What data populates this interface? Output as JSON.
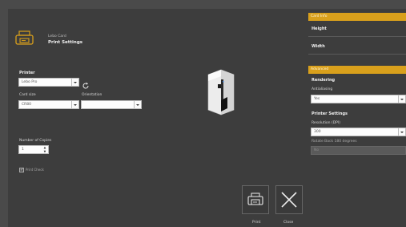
{
  "header": {
    "subtitle": "Lebo Card",
    "title": "Print Settings",
    "icon": "card-printer-icon"
  },
  "printer": {
    "label": "Printer",
    "value": "Lebo Pro",
    "refresh_icon": "refresh-icon"
  },
  "card_size": {
    "label": "Card size",
    "value": "CR80"
  },
  "orientation": {
    "label": "Orientation",
    "value": ""
  },
  "copies": {
    "label": "Number of Copies",
    "value": "1"
  },
  "print_check": {
    "label": "Print Check",
    "checked": true
  },
  "card_panel": {
    "header": "Card Info",
    "height_label": "Height",
    "width_label": "Width"
  },
  "advanced_panel": {
    "header": "Advanced",
    "rendering_title": "Rendering",
    "antialias_label": "Antialiasing",
    "antialias_value": "Yes",
    "printer_settings_title": "Printer Settings",
    "resolution_label": "Resolution (DPI)",
    "resolution_value": "300",
    "rotate_label": "Rotate Back 180 degrees",
    "rotate_value": "No"
  },
  "actions": {
    "print_label": "Print",
    "close_label": "Close"
  },
  "colors": {
    "accent": "#d9a01c",
    "background": "#3d3d3d"
  }
}
